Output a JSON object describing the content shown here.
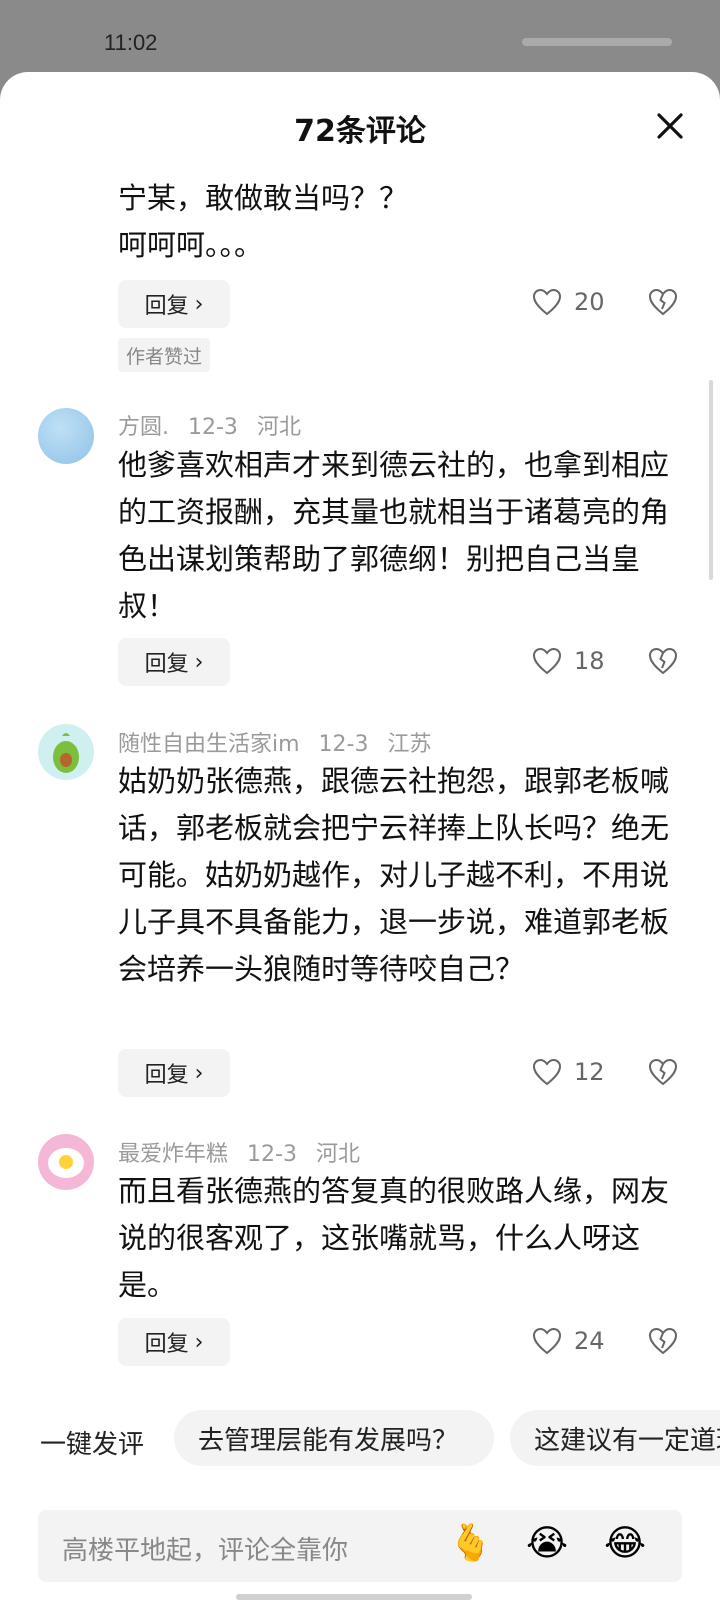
{
  "status_bar": {
    "time": "11:02"
  },
  "sheet": {
    "title": "72条评论"
  },
  "comments": [
    {
      "text": "宁某，敢做敢当吗？？\n呵呵呵。。。",
      "reply_label": "回复",
      "likes": "20",
      "author_tag": "作者赞过"
    },
    {
      "author": "方圆.",
      "date": "12-3",
      "location": "河北",
      "text": "他爹喜欢相声才来到德云社的，也拿到相应的工资报酬，充其量也就相当于诸葛亮的角色出谋划策帮助了郭德纲！别把自己当皇叔！",
      "reply_label": "回复",
      "likes": "18"
    },
    {
      "author": "随性自由生活家im",
      "date": "12-3",
      "location": "江苏",
      "text": "姑奶奶张德燕，跟德云社抱怨，跟郭老板喊话，郭老板就会把宁云祥捧上队长吗？绝无可能。姑奶奶越作，对儿子越不利，不用说儿子具不具备能力，退一步说，难道郭老板会培养一头狼随时等待咬自己？",
      "reply_label": "回复",
      "likes": "12"
    },
    {
      "author": "最爱炸年糕",
      "date": "12-3",
      "location": "河北",
      "text": "而且看张德燕的答复真的很败路人缘，网友说的很客观了，这张嘴就骂，什么人呀这是。",
      "reply_label": "回复",
      "likes": "24"
    }
  ],
  "quick_comment": {
    "label": "一键发评",
    "chips": [
      "去管理层能有发展吗？",
      "这建议有一定道理"
    ]
  },
  "input": {
    "placeholder": "高楼平地起，评论全靠你",
    "emojis": [
      "🫰",
      "😭",
      "😂"
    ]
  },
  "colors": {
    "background": "#ffffff",
    "muted_text": "#9a9a9a",
    "chip_bg": "#f3f3f3"
  }
}
